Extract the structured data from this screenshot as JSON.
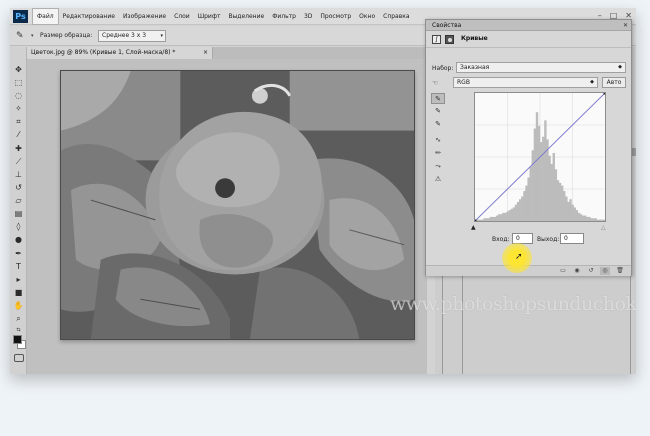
{
  "app": {
    "logo": "Ps",
    "menu": [
      "Файл",
      "Редактирование",
      "Изображение",
      "Слои",
      "Шрифт",
      "Выделение",
      "Фильтр",
      "3D",
      "Просмотр",
      "Окно",
      "Справка"
    ],
    "window_controls": [
      "–",
      "□",
      "✕"
    ]
  },
  "options_bar": {
    "label": "Размер образца:",
    "value": "Среднее 3 x 3"
  },
  "document": {
    "tab_title": "Цветок.jpg @ 89% (Кривые 1, Слой-маска/8) *",
    "close": "×"
  },
  "properties": {
    "title": "Свойства",
    "close": "✕",
    "section": "Кривые",
    "preset_label": "Набор:",
    "preset_value": "Заказная",
    "channel_value": "RGB",
    "auto_label": "Авто",
    "input_label": "Вход:",
    "input_value": "0",
    "output_label": "Выход:",
    "output_value": "0"
  },
  "curve": {
    "points": [
      [
        0,
        0
      ],
      [
        255,
        255
      ]
    ],
    "histogram": [
      1,
      1,
      1,
      1,
      2,
      2,
      2,
      3,
      3,
      3,
      4,
      5,
      5,
      6,
      6,
      7,
      8,
      9,
      10,
      12,
      14,
      16,
      18,
      22,
      26,
      32,
      40,
      52,
      68,
      80,
      70,
      58,
      62,
      74,
      60,
      48,
      42,
      50,
      38,
      30,
      28,
      26,
      22,
      18,
      14,
      16,
      12,
      10,
      8,
      6,
      5,
      4,
      4,
      3,
      3,
      2,
      2,
      2,
      1,
      1,
      1,
      1
    ],
    "line_color": "#7b7bd8",
    "diagonal_color": "#7a7a7a"
  },
  "watermark": "www.photoshopsunduchok.ru",
  "colors": {
    "highlight": "#ffe628"
  }
}
